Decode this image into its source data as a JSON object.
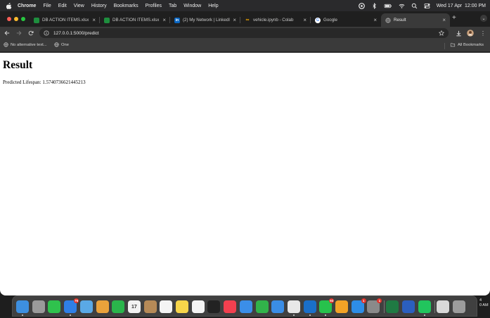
{
  "menubar": {
    "app_name": "Chrome",
    "items": [
      "File",
      "Edit",
      "View",
      "History",
      "Bookmarks",
      "Profiles",
      "Tab",
      "Window",
      "Help"
    ],
    "datetime": "Wed 17 Apr  12:00 PM",
    "status_icons": [
      "copilot-icon",
      "bluetooth-icon",
      "battery-icon",
      "wifi-icon",
      "search-icon",
      "control-center-icon"
    ]
  },
  "tabs": [
    {
      "title": "DB ACTION ITEMS.xlsx",
      "favicon": "sheets-icon",
      "color": "#1e8e3e"
    },
    {
      "title": "DB ACTION ITEMS.xlsx",
      "favicon": "sheets-icon",
      "color": "#1e8e3e"
    },
    {
      "title": "(2) My Network | LinkedIn",
      "favicon": "linkedin-icon",
      "color": "#0a66c2"
    },
    {
      "title": "vehicle.ipynb - Colab",
      "favicon": "colab-icon",
      "color": "#f9ab00"
    },
    {
      "title": "Google",
      "favicon": "google-icon",
      "color": "#4285f4"
    },
    {
      "title": "Result",
      "favicon": "globe-icon",
      "color": "#9aa0a6"
    }
  ],
  "toolbar": {
    "url": "127.0.0.1:5000/predict"
  },
  "bookmarks": {
    "items": [
      "No alternative text...",
      "One"
    ],
    "all_bookmarks": "All Bookmarks"
  },
  "page": {
    "heading": "Result",
    "prediction": "Predicted Lifespan: 1.5740736621445213"
  },
  "dock": {
    "apps": [
      {
        "name": "finder-icon",
        "color": "#3d8fe0",
        "dot": true
      },
      {
        "name": "launchpad-icon",
        "color": "#9a9a9a"
      },
      {
        "name": "messages-icon",
        "color": "#2fc24d"
      },
      {
        "name": "mail-icon",
        "color": "#2f7fe6",
        "badge": "76",
        "dot": true
      },
      {
        "name": "maps-icon",
        "color": "#5aa9e6"
      },
      {
        "name": "photos-icon",
        "color": "#e9a23b"
      },
      {
        "name": "facetime-icon",
        "color": "#2ab54b"
      },
      {
        "name": "calendar-icon",
        "color": "#f2f2f2",
        "label": "17"
      },
      {
        "name": "contacts-icon",
        "color": "#b68a57"
      },
      {
        "name": "reminders-icon",
        "color": "#f4f4f4"
      },
      {
        "name": "notes-icon",
        "color": "#f7d54a"
      },
      {
        "name": "freeform-icon",
        "color": "#f4f4f4"
      },
      {
        "name": "appletv-icon",
        "color": "#222222"
      },
      {
        "name": "music-icon",
        "color": "#f2404f"
      },
      {
        "name": "keynote-icon",
        "color": "#3b8ee8"
      },
      {
        "name": "numbers-icon",
        "color": "#31b34a"
      },
      {
        "name": "safari-icon",
        "color": "#3a8de6"
      },
      {
        "name": "chrome-icon",
        "color": "#e8e8e8",
        "dot": true
      },
      {
        "name": "outlook-icon",
        "color": "#1a6fc9",
        "dot": true
      },
      {
        "name": "whatsapp-icon",
        "color": "#27c24c",
        "badge": "93",
        "dot": true
      },
      {
        "name": "pages-icon",
        "color": "#f3a326"
      },
      {
        "name": "appstore-icon",
        "color": "#2d8de6",
        "badge": "1"
      },
      {
        "name": "settings-icon",
        "color": "#8a8a8a",
        "badge": "1"
      },
      {
        "name": "excel-icon",
        "color": "#1f7a43"
      },
      {
        "name": "word-icon",
        "color": "#2b5fbf"
      },
      {
        "name": "pycharm-icon",
        "color": "#21c55d",
        "dot": true
      },
      {
        "name": "documents-icon",
        "color": "#d9d9d9"
      },
      {
        "name": "trash-icon",
        "color": "#9c9c9c"
      }
    ],
    "clock_fragment": [
      "4",
      "0 AM"
    ]
  }
}
